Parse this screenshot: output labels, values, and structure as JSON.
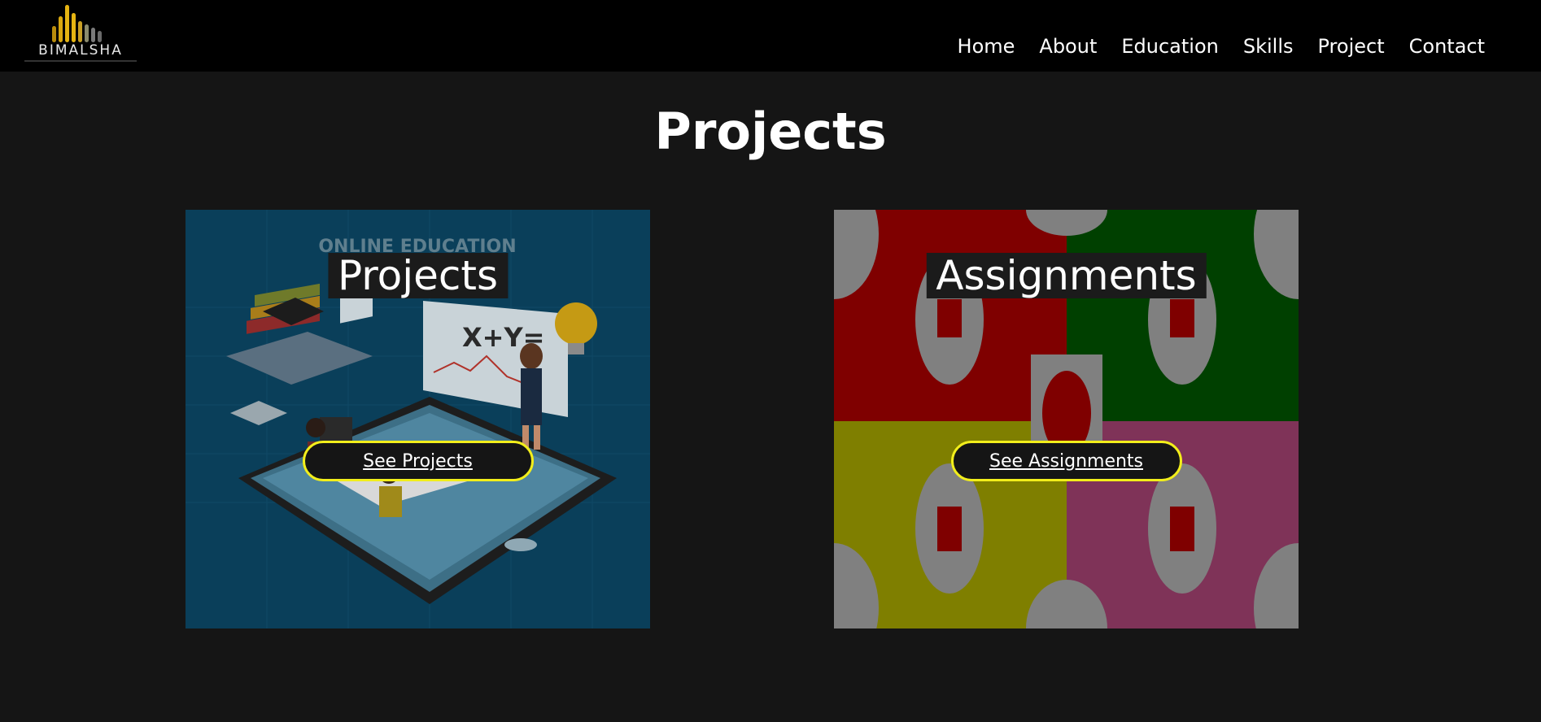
{
  "brand": {
    "name": "BIMALSHA",
    "bar_color": "#e5b412"
  },
  "nav": {
    "items": [
      {
        "label": "Home",
        "name": "nav-home"
      },
      {
        "label": "About",
        "name": "nav-about"
      },
      {
        "label": "Education",
        "name": "nav-education"
      },
      {
        "label": "Skills",
        "name": "nav-skills"
      },
      {
        "label": "Project",
        "name": "nav-project"
      },
      {
        "label": "Contact",
        "name": "nav-contact"
      }
    ]
  },
  "section": {
    "title": "Projects"
  },
  "cards": {
    "projects": {
      "heading": "Projects",
      "button_label": "See Projects",
      "image_caption": "ONLINE EDUCATION",
      "board_text": "X+Y="
    },
    "assignments": {
      "heading": "Assignments",
      "button_label": "See Assignments"
    }
  },
  "colors": {
    "accent": "#f2ee1b",
    "background": "#151515",
    "navbar": "#000000"
  }
}
